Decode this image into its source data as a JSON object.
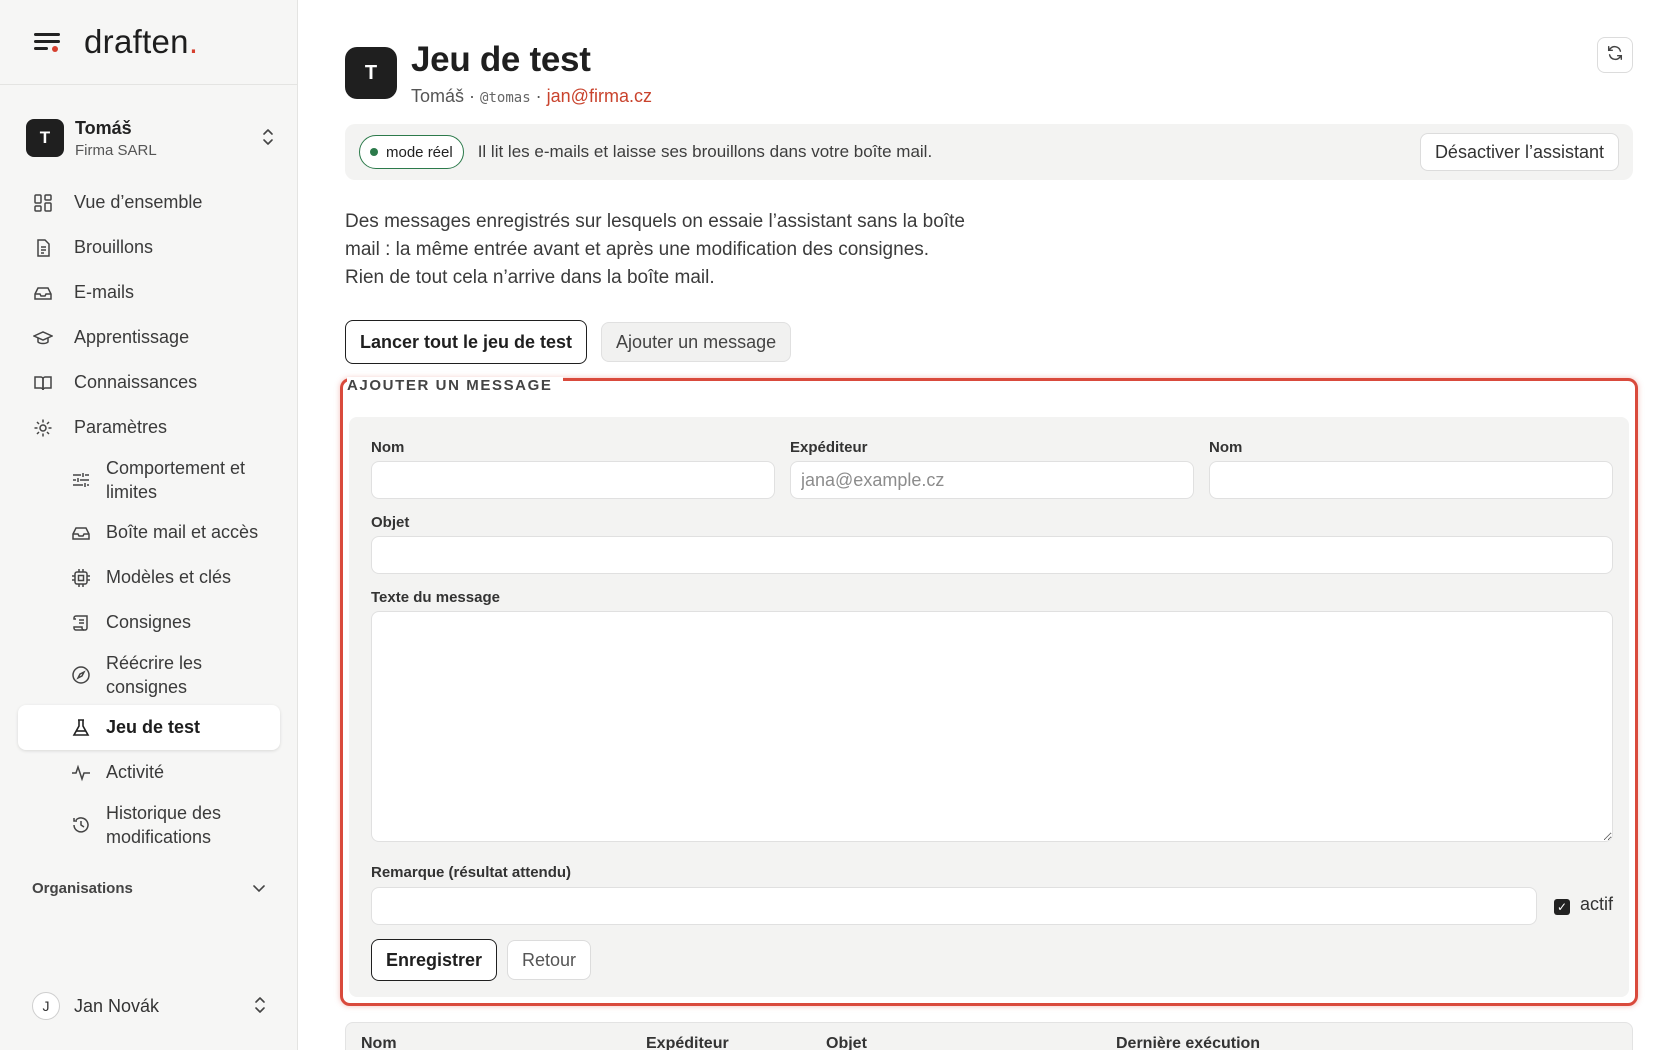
{
  "brand": {
    "name": "draften",
    "period": "."
  },
  "account": {
    "initial": "T",
    "name": "Tomáš",
    "org": "Firma SARL"
  },
  "nav": {
    "overview": "Vue d’ensemble",
    "drafts": "Brouillons",
    "emails": "E-mails",
    "learning": "Apprentissage",
    "knowledge": "Connaissances",
    "settings": "Paramètres",
    "behavior": "Comportement et limites",
    "mailbox": "Boîte mail et accès",
    "models": "Modèles et clés",
    "instructions": "Consignes",
    "rewrite": "Réécrire les consignes",
    "testset": "Jeu de test",
    "activity": "Activité",
    "history": "Historique des modifications"
  },
  "organisations": "Organisations",
  "user": {
    "initial": "J",
    "name": "Jan Novák"
  },
  "page": {
    "initial": "T",
    "title": "Jeu de test",
    "subtitle_name": "Tomáš",
    "sep": "·",
    "handle": "@tomas",
    "email": "jan@firma.cz"
  },
  "banner": {
    "mode": "mode réel",
    "text": "Il lit les e-mails et laisse ses brouillons dans votre boîte mail.",
    "disable": "Désactiver l’assistant"
  },
  "intro": "Des messages enregistrés sur lesquels on essaie l’assistant sans la boîte mail : la même entrée avant et après une modification des consignes. Rien de tout cela n’arrive dans la boîte mail.",
  "actions": {
    "run_all": "Lancer tout le jeu de test",
    "add_message": "Ajouter un message"
  },
  "form": {
    "legend": "AJOUTER UN MESSAGE",
    "name_label": "Nom",
    "sender_label": "Expéditeur",
    "sender_placeholder": "jana@example.cz",
    "name2_label": "Nom",
    "subject_label": "Objet",
    "body_label": "Texte du message",
    "note_label": "Remarque (résultat attendu)",
    "active_label": "actif",
    "active": true,
    "save": "Enregistrer",
    "back": "Retour"
  },
  "table": {
    "headers": [
      "Nom",
      "Expéditeur",
      "Objet",
      "Dernière exécution"
    ]
  },
  "colors": {
    "accent": "#d6402f",
    "live": "#2c7a4b",
    "highlight": "#d94a3c"
  }
}
